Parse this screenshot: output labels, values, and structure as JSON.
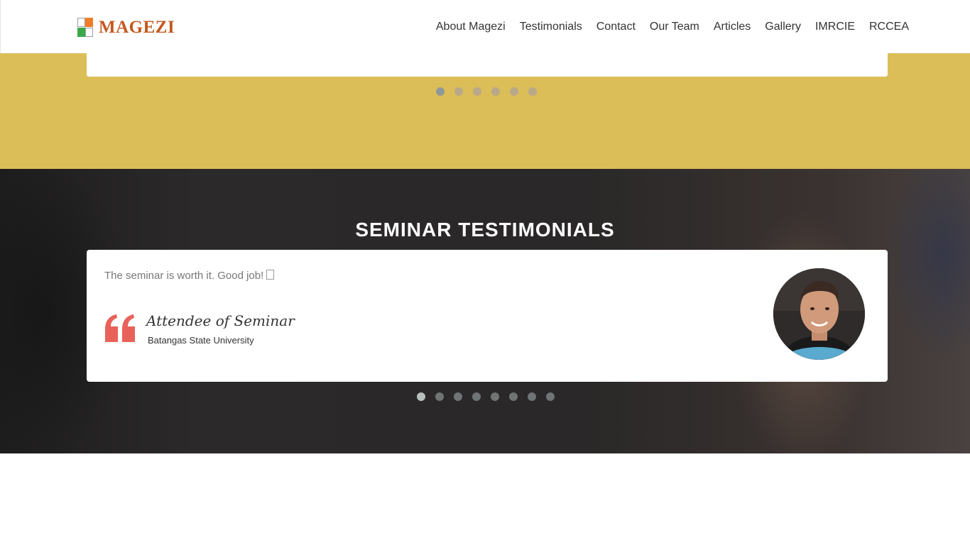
{
  "brand": {
    "name": "MAGEZI",
    "icon": "magezi-logo-icon"
  },
  "nav": {
    "items": [
      "About Magezi",
      "Testimonials",
      "Contact",
      "Our Team",
      "Articles",
      "Gallery",
      "IMRCIE",
      "RCCEA"
    ]
  },
  "colors": {
    "accent_yellow": "#dbbe57",
    "brand_orange": "#c4581e",
    "quote_red": "#e8625a"
  },
  "top_carousel": {
    "dot_count": 6,
    "active_index": 0
  },
  "testimonials": {
    "title": "SEMINAR TESTIMONIALS",
    "current": {
      "quote": "The seminar is worth it. Good job!",
      "author": "Attendee of Seminar",
      "organization": "Batangas State University",
      "avatar": "person-avatar-photo",
      "quote_icon": "quote-icon"
    },
    "dot_count": 8,
    "active_index": 0
  }
}
